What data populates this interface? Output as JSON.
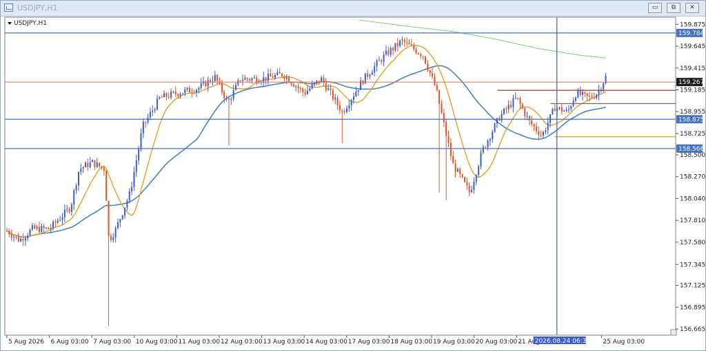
{
  "window": {
    "title": "USDJPY,H1",
    "minimize_label": "▭",
    "restore_label": "⧉",
    "close_label": "✕"
  },
  "chart_label": "USDJPY,H1",
  "price_labels": [
    {
      "text": "159.875",
      "y": 159.875
    },
    {
      "text": "159.645",
      "y": 159.645
    },
    {
      "text": "159.415",
      "y": 159.415
    },
    {
      "text": "159.185",
      "y": 159.185
    },
    {
      "text": "158.955",
      "y": 158.955
    },
    {
      "text": "158.725",
      "y": 158.725
    },
    {
      "text": "158.500",
      "y": 158.5
    },
    {
      "text": "158.270",
      "y": 158.27
    },
    {
      "text": "158.040",
      "y": 158.04
    },
    {
      "text": "157.810",
      "y": 157.81
    },
    {
      "text": "157.580",
      "y": 157.58
    },
    {
      "text": "157.345",
      "y": 157.345
    },
    {
      "text": "157.125",
      "y": 157.125
    },
    {
      "text": "156.895",
      "y": 156.895
    },
    {
      "text": "156.665",
      "y": 156.665
    }
  ],
  "time_labels": [
    {
      "text": "5 Aug 2026",
      "x": 0
    },
    {
      "text": "6 Aug 03:00",
      "x": 1
    },
    {
      "text": "7 Aug 03:00",
      "x": 2
    },
    {
      "text": "10 Aug 03:00",
      "x": 3
    },
    {
      "text": "11 Aug 03:00",
      "x": 4
    },
    {
      "text": "12 Aug 03:00",
      "x": 5
    },
    {
      "text": "13 Aug 03:00",
      "x": 6
    },
    {
      "text": "14 Aug 03:00",
      "x": 7
    },
    {
      "text": "17 Aug 03:00",
      "x": 8
    },
    {
      "text": "18 Aug 03:00",
      "x": 9
    },
    {
      "text": "19 Aug 03:00",
      "x": 10
    },
    {
      "text": "20 Aug 03:00",
      "x": 11
    },
    {
      "text": "21 Aug 03:00",
      "x": 12
    },
    {
      "text": "25 Aug 03:00",
      "x": 14
    }
  ],
  "crosshair_label": "2026.08.24 06:30",
  "hlines": [
    {
      "price": 159.784,
      "label": "159.784",
      "color": "#4472c4",
      "tagColor": "#4472c4"
    },
    {
      "price": 159.267,
      "label": "159.267",
      "color": "#e07060",
      "tagColor": "#1a1a1a",
      "current": true
    },
    {
      "price": 158.875,
      "label": "158.875",
      "color": "#4472c4",
      "tagColor": "#4472c4"
    },
    {
      "price": 158.566,
      "label": "158.566",
      "color": "#4472c4",
      "tagColor": "#4472c4"
    }
  ],
  "colors": {
    "bull": "#3a5bd1",
    "bear": "#e8501f",
    "ma_fast": "#e0a030",
    "ma_mid": "#4a86b8",
    "ma_slow": "#7ccf7c"
  },
  "chart_data": {
    "type": "candlestick",
    "title": "USDJPY,H1",
    "ylim": [
      156.6,
      159.95
    ],
    "x_range": [
      0,
      14.2
    ],
    "anchors": [
      [
        0.0,
        157.7
      ],
      [
        0.3,
        157.6
      ],
      [
        0.6,
        157.72
      ],
      [
        1.0,
        157.72
      ],
      [
        1.5,
        157.95
      ],
      [
        1.7,
        158.35
      ],
      [
        2.0,
        158.42
      ],
      [
        2.3,
        158.35
      ],
      [
        2.4,
        157.6
      ],
      [
        2.55,
        157.7
      ],
      [
        2.9,
        158.1
      ],
      [
        3.2,
        158.8
      ],
      [
        3.6,
        159.1
      ],
      [
        4.0,
        159.15
      ],
      [
        4.5,
        159.2
      ],
      [
        4.9,
        159.32
      ],
      [
        5.2,
        159.05
      ],
      [
        5.5,
        159.3
      ],
      [
        6.0,
        159.3
      ],
      [
        6.5,
        159.35
      ],
      [
        7.0,
        159.15
      ],
      [
        7.4,
        159.3
      ],
      [
        7.9,
        158.95
      ],
      [
        8.4,
        159.3
      ],
      [
        8.9,
        159.55
      ],
      [
        9.3,
        159.7
      ],
      [
        9.8,
        159.55
      ],
      [
        10.1,
        159.2
      ],
      [
        10.3,
        158.8
      ],
      [
        10.5,
        158.4
      ],
      [
        10.9,
        158.1
      ],
      [
        11.2,
        158.55
      ],
      [
        11.6,
        158.9
      ],
      [
        12.0,
        159.1
      ],
      [
        12.3,
        158.85
      ],
      [
        12.6,
        158.7
      ],
      [
        12.9,
        159.0
      ],
      [
        13.2,
        158.95
      ],
      [
        13.4,
        159.15
      ],
      [
        13.7,
        159.1
      ],
      [
        13.9,
        159.15
      ],
      [
        14.1,
        159.32
      ]
    ],
    "ma_slow_points": [
      [
        8.3,
        159.92
      ],
      [
        9.5,
        159.85
      ],
      [
        10.5,
        159.8
      ],
      [
        11.5,
        159.72
      ],
      [
        12.5,
        159.62
      ],
      [
        13.5,
        159.55
      ],
      [
        14.1,
        159.52
      ]
    ]
  }
}
